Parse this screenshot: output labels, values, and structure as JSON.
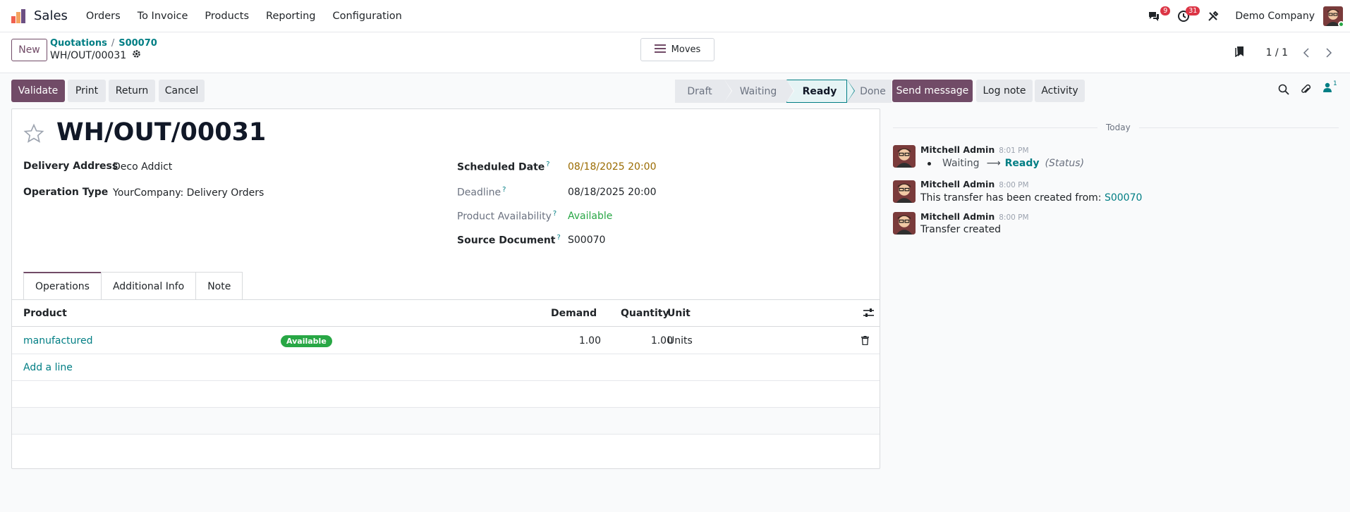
{
  "app": {
    "name": "Sales",
    "menu": [
      "Orders",
      "To Invoice",
      "Products",
      "Reporting",
      "Configuration"
    ],
    "messages_badge": "9",
    "activities_badge": "31",
    "company": "Demo Company",
    "colors": {
      "brand": "#714b67",
      "link": "#017e84",
      "success": "#28a745",
      "danger": "#dc3545"
    }
  },
  "control": {
    "new_label": "New",
    "breadcrumbs": [
      "Quotations",
      "S00070"
    ],
    "record": "WH/OUT/00031",
    "moves_label": "Moves",
    "pager": "1 / 1"
  },
  "actions": {
    "validate": "Validate",
    "print": "Print",
    "return": "Return",
    "cancel": "Cancel"
  },
  "statusbar": {
    "stages": [
      "Draft",
      "Waiting",
      "Ready",
      "Done"
    ],
    "active": "Ready"
  },
  "form": {
    "title": "WH/OUT/00031",
    "delivery_address_label": "Delivery Address",
    "delivery_address": "Deco Addict",
    "operation_type_label": "Operation Type",
    "operation_type": "YourCompany: Delivery Orders",
    "scheduled_date_label": "Scheduled Date",
    "scheduled_date": "08/18/2025 20:00",
    "deadline_label": "Deadline",
    "deadline": "08/18/2025 20:00",
    "availability_label": "Product Availability",
    "availability": "Available",
    "source_document_label": "Source Document",
    "source_document": "S00070",
    "help_marker": "?",
    "tabs": [
      "Operations",
      "Additional Info",
      "Note"
    ],
    "table": {
      "columns": [
        "Product",
        "Demand",
        "Quantity",
        "Unit"
      ],
      "rows": [
        {
          "product": "manufactured",
          "status": "Available",
          "demand": "1.00",
          "quantity": "1.00",
          "unit": "Units"
        }
      ],
      "add_line": "Add a line"
    }
  },
  "chatter": {
    "send_message": "Send message",
    "log_note": "Log note",
    "activity": "Activity",
    "followers_count": "1",
    "date_separator": "Today",
    "messages": [
      {
        "author": "Mitchell Admin",
        "time": "8:01 PM",
        "from": "Waiting",
        "to": "Ready",
        "field": "(Status)"
      },
      {
        "author": "Mitchell Admin",
        "time": "8:00 PM",
        "body": "This transfer has been created from:",
        "link": "S00070"
      },
      {
        "author": "Mitchell Admin",
        "time": "8:00 PM",
        "body": "Transfer created"
      }
    ]
  }
}
